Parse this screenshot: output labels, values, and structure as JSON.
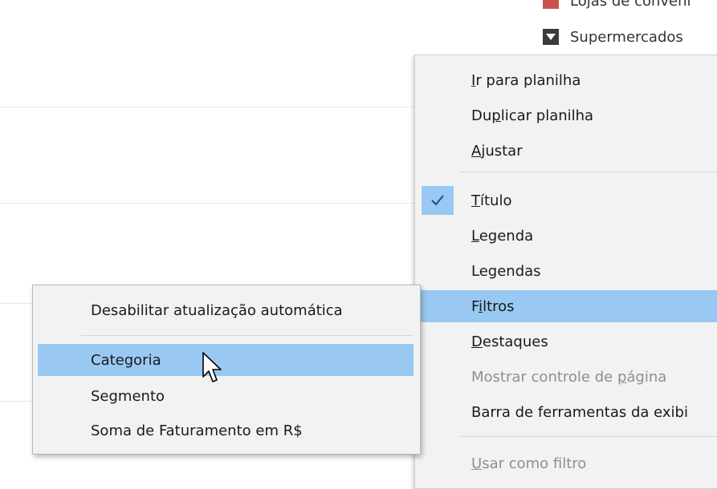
{
  "legend": {
    "items": [
      {
        "label": "Lojas de conveni"
      },
      {
        "label": "Supermercados"
      }
    ]
  },
  "menu": {
    "items": [
      {
        "pre": "",
        "key": "I",
        "post": "r para planilha"
      },
      {
        "pre": "Du",
        "key": "p",
        "post": "licar planilha"
      },
      {
        "pre": "",
        "key": "A",
        "post": "justar"
      },
      {
        "pre": "",
        "key": "T",
        "post": "ítulo"
      },
      {
        "pre": "",
        "key": "L",
        "post": "egenda"
      },
      {
        "pre": "Legendas",
        "key": "",
        "post": ""
      },
      {
        "pre": "F",
        "key": "i",
        "post": "ltros"
      },
      {
        "pre": "",
        "key": "D",
        "post": "estaques"
      },
      {
        "pre": "Mostrar controle de ",
        "key": "p",
        "post": "ágina"
      },
      {
        "pre": "Barra de ferramentas da exibi",
        "key": "",
        "post": ""
      },
      {
        "pre": "",
        "key": "U",
        "post": "sar como filtro"
      }
    ]
  },
  "submenu": {
    "items": [
      {
        "label": "Desabilitar atualização automática"
      },
      {
        "label": "Categoria"
      },
      {
        "label": "Segmento"
      },
      {
        "label": "Soma de Faturamento em R$"
      }
    ]
  },
  "colors": {
    "highlight": "#99c9f2",
    "menu_bg": "#f2f2f2",
    "disabled_text": "#8e8e8e"
  }
}
